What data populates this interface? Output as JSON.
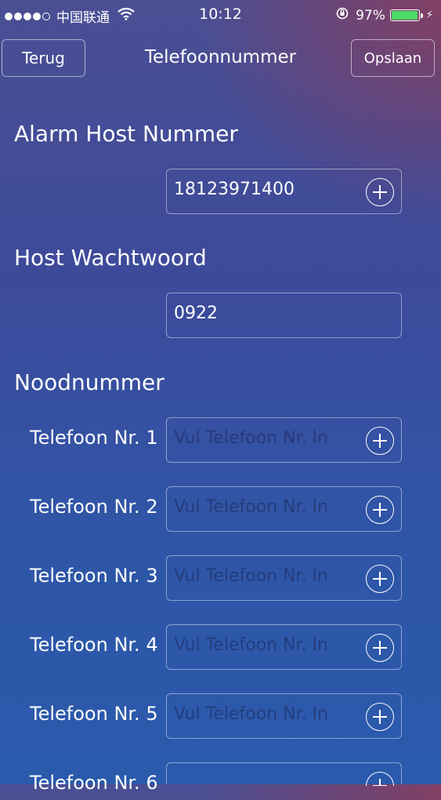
{
  "status_bar": {
    "carrier": "中国联通",
    "time": "10:12",
    "battery_percent": "97%",
    "battery_level": 0.97
  },
  "navbar": {
    "back_label": "Terug",
    "title": "Telefoonnummer",
    "save_label": "Opslaan"
  },
  "alarm_host": {
    "title": "Alarm Host Nummer",
    "value": "18123971400"
  },
  "host_password": {
    "title": "Host Wachtwoord",
    "value": "0922"
  },
  "emergency": {
    "title": "Noodnummer",
    "placeholder": "Vul Telefoon Nr. In",
    "rows": [
      {
        "label": "Telefoon Nr. 1"
      },
      {
        "label": "Telefoon Nr. 2"
      },
      {
        "label": "Telefoon Nr. 3"
      },
      {
        "label": "Telefoon Nr. 4"
      },
      {
        "label": "Telefoon Nr. 5"
      },
      {
        "label": "Telefoon Nr. 6"
      }
    ]
  },
  "colors": {
    "battery_fill": "#4cd964",
    "placeholder_text": "#1e285a"
  }
}
